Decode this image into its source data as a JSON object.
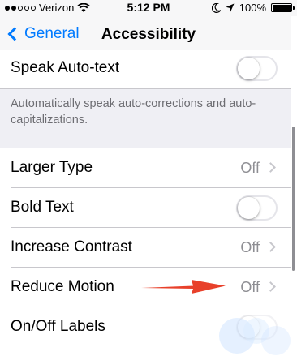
{
  "status_bar": {
    "carrier": "Verizon",
    "time": "5:12 PM",
    "battery": "100%",
    "signal_icon": "signal-dots-icon",
    "wifi_icon": "wifi-icon",
    "moon_icon": "moon-icon",
    "location_icon": "location-arrow-icon",
    "battery_icon": "battery-icon"
  },
  "nav": {
    "back_label": "General",
    "title": "Accessibility"
  },
  "speak_auto_text": {
    "label": "Speak Auto-text",
    "enabled": false
  },
  "speak_auto_text_footer": "Automatically speak auto-corrections and auto-capitalizations.",
  "rows": [
    {
      "label": "Larger Type",
      "value": "Off"
    },
    {
      "label": "Bold Text",
      "enabled": false
    },
    {
      "label": "Increase Contrast",
      "value": "Off"
    },
    {
      "label": "Reduce Motion",
      "value": "Off"
    },
    {
      "label": "On/Off Labels"
    }
  ],
  "annotation": {
    "color": "#e8402a"
  },
  "colors": {
    "accent": "#007aff",
    "background": "#efeff4",
    "separator": "#c8c7cc",
    "secondary_text": "#8e8e93"
  }
}
